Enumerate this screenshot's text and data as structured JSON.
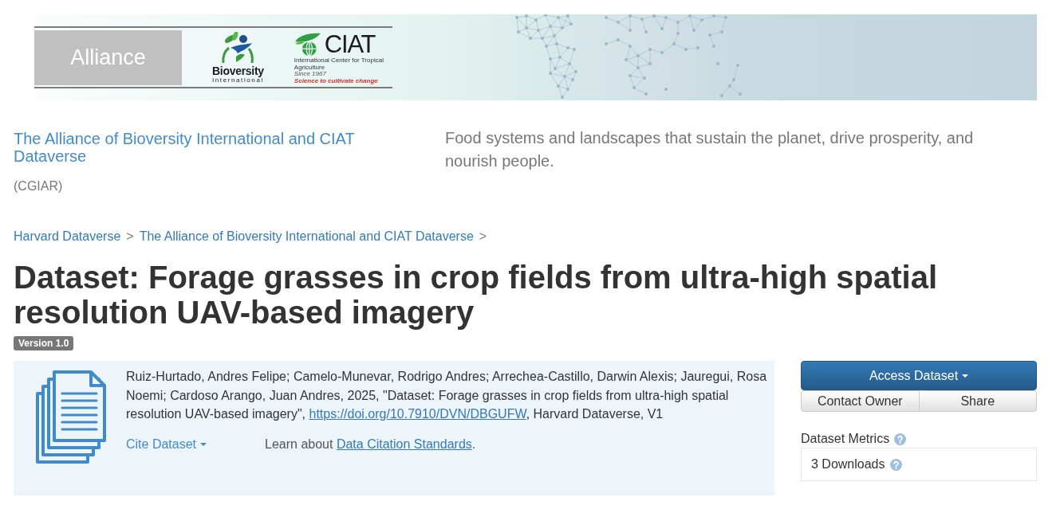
{
  "banner": {
    "logos": [
      {
        "kind": "alliance",
        "name": "Alliance"
      },
      {
        "kind": "bioversity",
        "name": "Bioversity",
        "subtitle": "International"
      },
      {
        "kind": "ciat",
        "name": "CIAT",
        "subtitle": "International Center for Tropical Agriculture",
        "since": "Since 1967",
        "motto": "Science to cultivate change"
      }
    ]
  },
  "dataverse": {
    "name": "The Alliance of Bioversity International and CIAT Dataverse",
    "affiliation": "(CGIAR)",
    "tagline": "Food systems and landscapes that sustain the planet, drive prosperity, and nourish people."
  },
  "breadcrumbs": [
    {
      "label": "Harvard Dataverse",
      "separator": ">"
    },
    {
      "label": "The Alliance of Bioversity International and CIAT Dataverse",
      "separator": ">"
    }
  ],
  "dataset": {
    "title": "Dataset: Forage grasses in crop fields from ultra-high spatial resolution UAV-based imagery",
    "version": "Version 1.0"
  },
  "citation": {
    "text_before": "Ruiz-Hurtado, Andres Felipe; Camelo-Munevar, Rodrigo Andres; Arrechea-Castillo, Darwin Alexis; Jauregui, Rosa Noemi; Cardoso Arango, Juan Andres, 2025, \"Dataset: Forage grasses in crop fields from ultra-high spatial resolution UAV-based imagery\",",
    "doi_link": "https://doi.org/10.7910/DVN/DBGUFW",
    "text_after": ", Harvard Dataverse, V1",
    "cite_button": "Cite Dataset",
    "standards_prefix": "Learn about",
    "standards_link": "Data Citation Standards",
    "standards_suffix": "."
  },
  "actions": {
    "primary": "Access Dataset",
    "secondary": [
      "Contact Owner",
      "Share"
    ]
  },
  "metrics": {
    "title": "Dataset Metrics",
    "downloads": "3 Downloads"
  }
}
